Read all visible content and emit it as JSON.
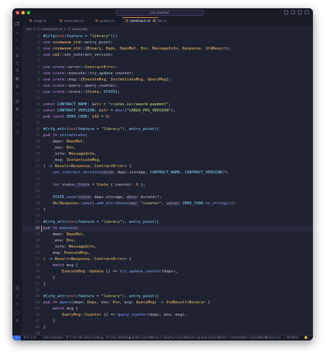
{
  "window": {
    "search_text": "cw-starter",
    "traffic_lights": {
      "close": "#ff5f57",
      "minimize": "#febc2e",
      "zoom": "#28c840"
    }
  },
  "activity_bar": {
    "icons": [
      "files-icon",
      "search-icon",
      "source-control-icon",
      "run-debug-icon",
      "extensions-icon",
      "remote-icon",
      "testing-icon",
      "docker-icon",
      "database-icon",
      "git-graph-icon",
      "notebook-icon",
      "copilot-icon",
      "chat-icon",
      "terminal-icon",
      "timeline-icon",
      "book-icon",
      "bookmark-icon",
      "sync-icon",
      "account-icon",
      "settings-icon"
    ]
  },
  "tabs": [
    {
      "label": "msg.rs",
      "active": false
    },
    {
      "label": "execute.rs",
      "active": false
    },
    {
      "label": "query.rs",
      "active": false
    },
    {
      "label": "contract.rs",
      "active": true,
      "close": "×"
    },
    {
      "label": "lib.rs",
      "active": false
    }
  ],
  "breadcrumb": "src > ⬡ contract.rs > ⬡ execute",
  "editor": {
    "current_line": 32,
    "lines": [
      {
        "n": 1,
        "segs": [
          [
            "#[cfg(",
            "c"
          ],
          [
            "not",
            "p"
          ],
          [
            "(feature = ",
            "c"
          ],
          [
            "\"library\"",
            "s"
          ],
          [
            "))]",
            "c"
          ]
        ]
      },
      {
        "n": 2,
        "segs": [
          [
            "use ",
            "k"
          ],
          [
            "cosmwasm_std",
            "t"
          ],
          [
            "::entry_point;",
            ""
          ]
        ]
      },
      {
        "n": 3,
        "segs": [
          [
            "use ",
            "k"
          ],
          [
            "cosmwasm_std",
            "t"
          ],
          [
            "::{",
            ""
          ],
          [
            "Binary",
            "t"
          ],
          [
            ", ",
            ""
          ],
          [
            "Deps",
            "t"
          ],
          [
            ", ",
            ""
          ],
          [
            "DepsMut",
            "t"
          ],
          [
            ", ",
            ""
          ],
          [
            "Env",
            "t"
          ],
          [
            ", ",
            ""
          ],
          [
            "MessageInfo",
            "t"
          ],
          [
            ", ",
            ""
          ],
          [
            "Response",
            "t"
          ],
          [
            ", ",
            ""
          ],
          [
            "StdResult",
            "t"
          ],
          [
            "};",
            ""
          ]
        ]
      },
      {
        "n": 4,
        "segs": [
          [
            "use ",
            "k"
          ],
          [
            "cw2",
            "t"
          ],
          [
            "::set_contract_version;",
            ""
          ]
        ]
      },
      {
        "n": 5,
        "segs": []
      },
      {
        "n": 6,
        "segs": [
          [
            "use ",
            "k"
          ],
          [
            "crate",
            "k"
          ],
          [
            "::error::",
            ""
          ],
          [
            "ContractError",
            "t"
          ],
          [
            ";",
            ""
          ]
        ]
      },
      {
        "n": 7,
        "segs": [
          [
            "use ",
            "k"
          ],
          [
            "crate",
            "k"
          ],
          [
            "::execute::try_update_counter;",
            ""
          ]
        ]
      },
      {
        "n": 8,
        "segs": [
          [
            "use ",
            "k"
          ],
          [
            "crate",
            "k"
          ],
          [
            "::msg::{",
            ""
          ],
          [
            "ExecuteMsg",
            "t"
          ],
          [
            ", ",
            ""
          ],
          [
            "InstantiateMsg",
            "t"
          ],
          [
            ", ",
            ""
          ],
          [
            "QueryMsg",
            "t"
          ],
          [
            "};",
            ""
          ]
        ]
      },
      {
        "n": 9,
        "segs": [
          [
            "use ",
            "k"
          ],
          [
            "crate",
            "k"
          ],
          [
            "::query::query_counter;",
            ""
          ]
        ]
      },
      {
        "n": 10,
        "segs": [
          [
            "use ",
            "k"
          ],
          [
            "crate",
            "k"
          ],
          [
            "::state::{",
            ""
          ],
          [
            "State",
            "t"
          ],
          [
            ", ",
            ""
          ],
          [
            "STATE",
            "c"
          ],
          [
            "};",
            ""
          ]
        ]
      },
      {
        "n": 11,
        "segs": []
      },
      {
        "n": 12,
        "segs": [
          [
            "const ",
            "k"
          ],
          [
            "CONTRACT_NAME",
            "c"
          ],
          [
            ": &",
            ""
          ],
          [
            "str",
            "t"
          ],
          [
            " = ",
            ""
          ],
          [
            "\"crates.io:reward-payment\"",
            "s"
          ],
          [
            ";",
            ""
          ]
        ]
      },
      {
        "n": 13,
        "segs": [
          [
            "const ",
            "k"
          ],
          [
            "CONTRACT_VERSION",
            "c"
          ],
          [
            ": &",
            ""
          ],
          [
            "str",
            "t"
          ],
          [
            " = ",
            ""
          ],
          [
            "env!",
            "f"
          ],
          [
            "(",
            ""
          ],
          [
            "\"CARGO_PKG_VERSION\"",
            "s"
          ],
          [
            ");",
            ""
          ]
        ]
      },
      {
        "n": 14,
        "segs": [
          [
            "pub const ",
            "k"
          ],
          [
            "ZERO_CODE",
            "c"
          ],
          [
            ": ",
            ""
          ],
          [
            "i32",
            "t"
          ],
          [
            " = ",
            ""
          ],
          [
            "0",
            "n"
          ],
          [
            ";",
            ""
          ]
        ]
      },
      {
        "n": 15,
        "segs": []
      },
      {
        "n": 16,
        "segs": [
          [
            "#[cfg_attr(",
            "c"
          ],
          [
            "not",
            "p"
          ],
          [
            "(feature = ",
            "c"
          ],
          [
            "\"library\"",
            "s"
          ],
          [
            "), entry_point)]",
            "c"
          ]
        ]
      },
      {
        "n": 17,
        "segs": [
          [
            "pub fn ",
            "k"
          ],
          [
            "instantiate",
            "f"
          ],
          [
            "(",
            ""
          ]
        ]
      },
      {
        "n": 18,
        "segs": [
          [
            "    deps: ",
            ""
          ],
          [
            "DepsMut",
            "t"
          ],
          [
            ",",
            ""
          ]
        ]
      },
      {
        "n": 19,
        "segs": [
          [
            "    _env: ",
            ""
          ],
          [
            "Env",
            "t"
          ],
          [
            ",",
            ""
          ]
        ]
      },
      {
        "n": 20,
        "segs": [
          [
            "    _info: ",
            ""
          ],
          [
            "MessageInfo",
            "t"
          ],
          [
            ",",
            ""
          ]
        ]
      },
      {
        "n": 21,
        "segs": [
          [
            "    _msg: ",
            ""
          ],
          [
            "InstantiateMsg",
            "t"
          ],
          [
            ",",
            ""
          ]
        ]
      },
      {
        "n": 22,
        "segs": [
          [
            ") -> ",
            ""
          ],
          [
            "Result",
            "t"
          ],
          [
            "<",
            ""
          ],
          [
            "Response",
            "t"
          ],
          [
            ", ",
            ""
          ],
          [
            "ContractError",
            "t"
          ],
          [
            "> {",
            ""
          ]
        ]
      },
      {
        "n": 23,
        "segs": [
          [
            "    ",
            ""
          ],
          [
            "set_contract_version",
            "f"
          ],
          [
            "(",
            ""
          ],
          [
            "store:",
            "hint"
          ],
          [
            " deps.storage, ",
            ""
          ],
          [
            "CONTRACT_NAME",
            "c"
          ],
          [
            ", ",
            ""
          ],
          [
            "CONTRACT_VERSION",
            "c"
          ],
          [
            ")?;",
            ""
          ]
        ]
      },
      {
        "n": 24,
        "segs": []
      },
      {
        "n": 25,
        "segs": [
          [
            "    ",
            ""
          ],
          [
            "let ",
            "k"
          ],
          [
            "state",
            ""
          ],
          [
            ": State",
            "hint"
          ],
          [
            " = ",
            ""
          ],
          [
            "State",
            "t"
          ],
          [
            " { counter: ",
            ""
          ],
          [
            "0",
            "n"
          ],
          [
            " };",
            ""
          ]
        ]
      },
      {
        "n": 26,
        "segs": []
      },
      {
        "n": 27,
        "segs": [
          [
            "    ",
            ""
          ],
          [
            "STATE",
            "c"
          ],
          [
            ".",
            ""
          ],
          [
            "save",
            "f"
          ],
          [
            "(",
            ""
          ],
          [
            "store:",
            "hint"
          ],
          [
            " deps.storage, ",
            ""
          ],
          [
            "data:",
            "hint"
          ],
          [
            " &state)?;",
            ""
          ]
        ]
      },
      {
        "n": 28,
        "segs": [
          [
            "    ",
            ""
          ],
          [
            "Ok",
            "t"
          ],
          [
            "(",
            ""
          ],
          [
            "Response",
            "t"
          ],
          [
            "::",
            ""
          ],
          [
            "new",
            "f"
          ],
          [
            "().",
            ""
          ],
          [
            "add_attribute",
            "f"
          ],
          [
            "(",
            ""
          ],
          [
            "key:",
            "hint"
          ],
          [
            " ",
            ""
          ],
          [
            "\"counter\"",
            "s"
          ],
          [
            ", ",
            ""
          ],
          [
            "value:",
            "hint"
          ],
          [
            " ",
            ""
          ],
          [
            "ZERO_CODE",
            "c"
          ],
          [
            ".",
            ""
          ],
          [
            "to_string",
            "f"
          ],
          [
            "()))",
            ""
          ]
        ]
      },
      {
        "n": 29,
        "segs": [
          [
            "}",
            ""
          ]
        ]
      },
      {
        "n": 30,
        "segs": []
      },
      {
        "n": 31,
        "segs": [
          [
            "#[cfg_attr(",
            "c"
          ],
          [
            "not",
            "p"
          ],
          [
            "(feature = ",
            "c"
          ],
          [
            "\"library\"",
            "s"
          ],
          [
            "), entry_point)]",
            "c"
          ]
        ]
      },
      {
        "n": 32,
        "segs": [
          [
            "pub fn ",
            "k"
          ],
          [
            "execute",
            "f"
          ],
          [
            "(",
            "br"
          ]
        ]
      },
      {
        "n": 33,
        "segs": [
          [
            "    deps: ",
            ""
          ],
          [
            "DepsMut",
            "t"
          ],
          [
            ",",
            ""
          ]
        ]
      },
      {
        "n": 34,
        "segs": [
          [
            "    _env: ",
            ""
          ],
          [
            "Env",
            "t"
          ],
          [
            ",",
            ""
          ]
        ]
      },
      {
        "n": 35,
        "segs": [
          [
            "    _info: ",
            ""
          ],
          [
            "MessageInfo",
            "t"
          ],
          [
            ",",
            ""
          ]
        ]
      },
      {
        "n": 36,
        "segs": [
          [
            "    msg: ",
            ""
          ],
          [
            "ExecuteMsg",
            "t"
          ],
          [
            ",",
            ""
          ]
        ]
      },
      {
        "n": 37,
        "segs": [
          [
            ")",
            "br"
          ],
          [
            " -> ",
            ""
          ],
          [
            "Result",
            "t"
          ],
          [
            "<",
            ""
          ],
          [
            "Response",
            "t"
          ],
          [
            ", ",
            ""
          ],
          [
            "ContractError",
            "t"
          ],
          [
            "> {",
            ""
          ]
        ]
      },
      {
        "n": 38,
        "segs": [
          [
            "    ",
            ""
          ],
          [
            "match ",
            "k"
          ],
          [
            "msg {",
            ""
          ]
        ]
      },
      {
        "n": 39,
        "segs": [
          [
            "        ",
            ""
          ],
          [
            "ExecuteMsg",
            "t"
          ],
          [
            "::",
            ""
          ],
          [
            "Update",
            "t"
          ],
          [
            " {} => ",
            ""
          ],
          [
            "try_update_counter",
            "f"
          ],
          [
            "(deps),",
            ""
          ]
        ]
      },
      {
        "n": 40,
        "segs": [
          [
            "    }",
            ""
          ]
        ]
      },
      {
        "n": 41,
        "segs": [
          [
            "}",
            ""
          ]
        ]
      },
      {
        "n": 42,
        "segs": []
      },
      {
        "n": 43,
        "segs": [
          [
            "#[cfg_attr(",
            "c"
          ],
          [
            "not",
            "p"
          ],
          [
            "(feature = ",
            "c"
          ],
          [
            "\"library\"",
            "s"
          ],
          [
            "), entry_point)]",
            "c"
          ]
        ]
      },
      {
        "n": 44,
        "segs": [
          [
            "pub fn ",
            "k"
          ],
          [
            "query",
            "f"
          ],
          [
            "(deps: ",
            ""
          ],
          [
            "Deps",
            "t"
          ],
          [
            ", env: ",
            ""
          ],
          [
            "Env",
            "t"
          ],
          [
            ", msg: ",
            ""
          ],
          [
            "QueryMsg",
            "t"
          ],
          [
            ") -> ",
            ""
          ],
          [
            "StdResult",
            "t"
          ],
          [
            "<",
            ""
          ],
          [
            "Binary",
            "t"
          ],
          [
            "> {",
            ""
          ]
        ]
      },
      {
        "n": 45,
        "segs": [
          [
            "    ",
            ""
          ],
          [
            "match ",
            "k"
          ],
          [
            "msg {",
            ""
          ]
        ]
      },
      {
        "n": 46,
        "segs": [
          [
            "        ",
            ""
          ],
          [
            "QueryMsg",
            "t"
          ],
          [
            "::",
            ""
          ],
          [
            "Counter",
            "t"
          ],
          [
            " {} => ",
            ""
          ],
          [
            "query_counter",
            "f"
          ],
          [
            "(deps, env, msg),",
            ""
          ]
        ]
      },
      {
        "n": 47,
        "segs": [
          [
            "    }",
            ""
          ]
        ]
      },
      {
        "n": 48,
        "segs": [
          [
            "}",
            ""
          ]
        ]
      },
      {
        "n": 49,
        "segs": []
      }
    ]
  },
  "statusbar": {
    "remote": "⌁",
    "items": [
      "⊗ 0 ⚠ 0",
      "rust-analyzer",
      "⏱ 7 hrs 46 mins Coding, 15 secs Building",
      "▸ Build CosmWasm",
      "⇧ Deploy CosmWasm",
      "⇧ Upload CosmWasm",
      "⇧ Instantiate CosmWasm",
      "⊛ Go Live",
      "✓ Prettier",
      "🔔"
    ]
  }
}
